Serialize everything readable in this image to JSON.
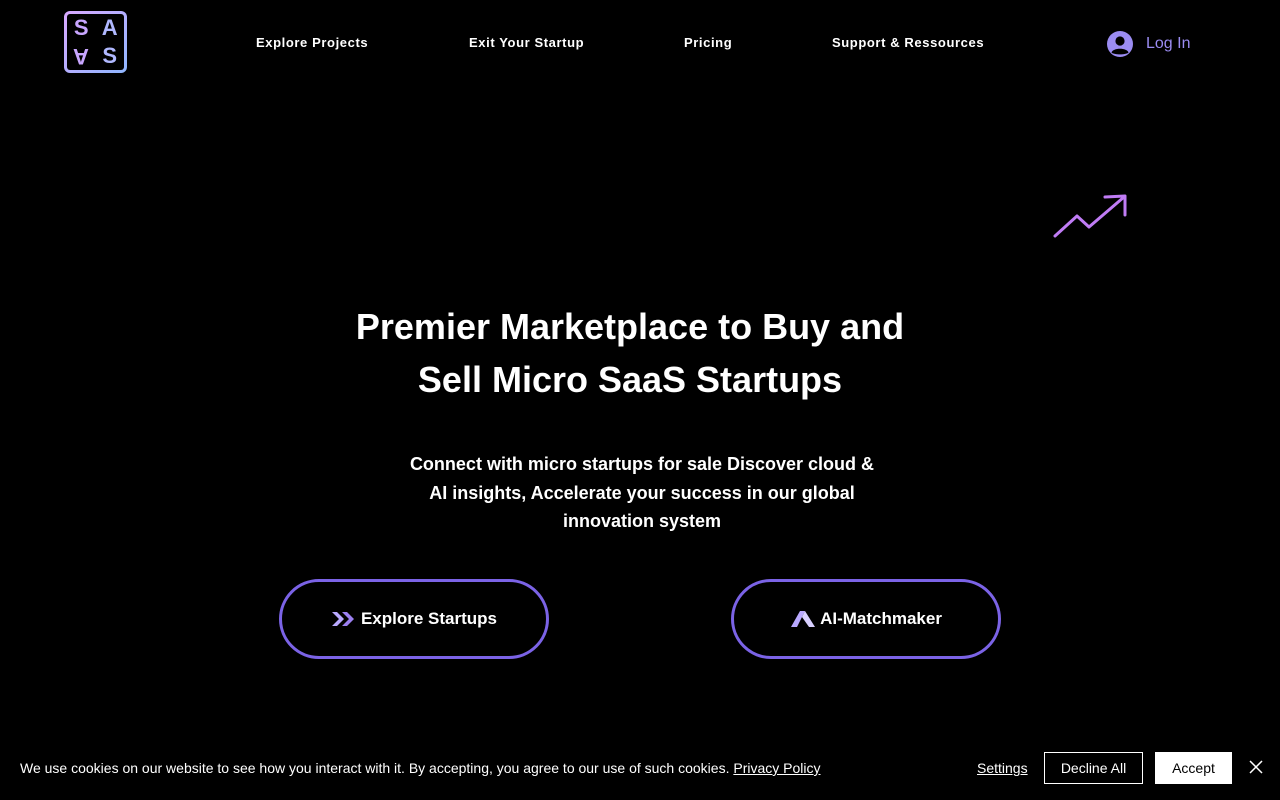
{
  "header": {
    "logo_letters": [
      "S",
      "A",
      "A",
      "S"
    ],
    "nav": [
      {
        "label": "Explore Projects"
      },
      {
        "label": "Exit Your Startup"
      },
      {
        "label": "Pricing"
      },
      {
        "label": "Support & Ressources"
      }
    ],
    "login_label": "Log In"
  },
  "hero": {
    "title_line1": "Premier Marketplace to Buy and",
    "title_line2": "Sell Micro SaaS Startups",
    "sub_line1": "Connect with micro startups for sale Discover cloud &",
    "sub_line2": "AI insights, Accelerate your success in our global",
    "sub_line3": "innovation system",
    "decor_icon": "trending-up-icon"
  },
  "cta": {
    "explore_label": "Explore Startups",
    "explore_icon": "double-chevron-right-icon",
    "ai_label": "AI-Matchmaker",
    "ai_icon": "mountain-logo-icon"
  },
  "cookie": {
    "text": "We use cookies on our website to see how you interact with it. By accepting, you agree to our use of such cookies. ",
    "privacy_label": "Privacy Policy",
    "settings_label": "Settings",
    "decline_label": "Decline All",
    "accept_label": "Accept"
  },
  "colors": {
    "accent": "#7b63e6",
    "login_text": "#9b8cf2",
    "trend_icon": "#c07cf5"
  }
}
